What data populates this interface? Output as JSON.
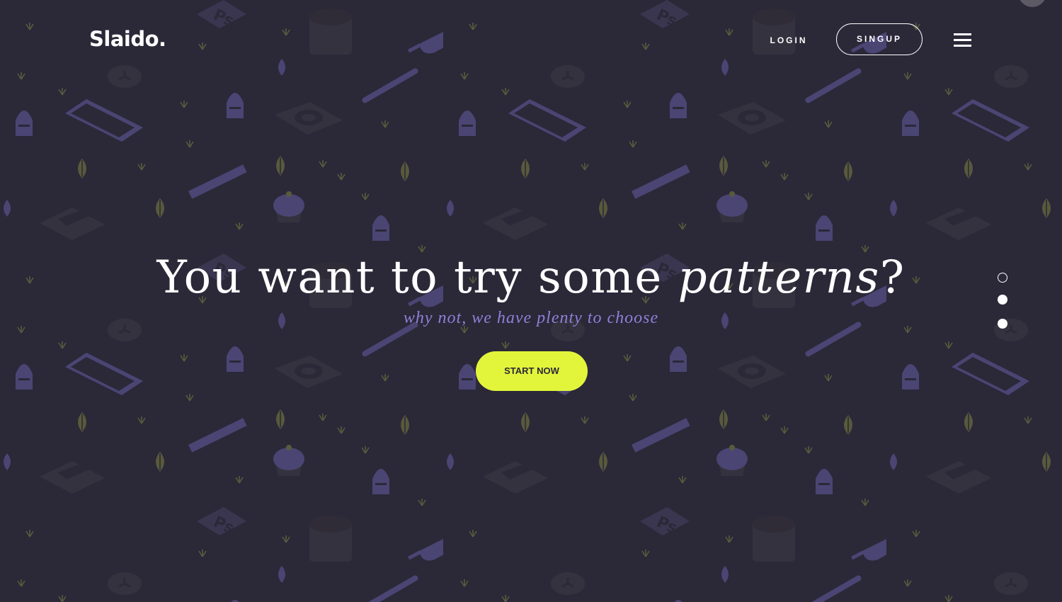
{
  "brand": {
    "logo_text": "Slaido."
  },
  "nav": {
    "login_label": "LOGIN",
    "signup_label": "SINGUP",
    "menu_icon": "hamburger-menu-icon"
  },
  "hero": {
    "headline_prefix": "You want to try some ",
    "headline_emphasis": "patterns",
    "headline_suffix": "?",
    "subline": "why not, we have plenty to choose",
    "cta_label": "START NOW"
  },
  "slider": {
    "slides": 3,
    "active_index": 0
  },
  "colors": {
    "background": "#2b2838",
    "accent": "#e2f53b",
    "subline": "#8f80d6",
    "pattern_purple": "#4a4573",
    "pattern_leaf": "#585a3c",
    "text": "#ffffff"
  },
  "pattern_icons": [
    "photoshop-file-icon",
    "coffee-mug-icon",
    "ice-pop-icon",
    "pen-icon",
    "clock-icon",
    "smartphone-icon",
    "rocket-icon",
    "camera-lens-icon",
    "leaf-icon",
    "ruler-icon",
    "cupcake-icon",
    "music-file-icon",
    "grass-sprout-icon"
  ]
}
